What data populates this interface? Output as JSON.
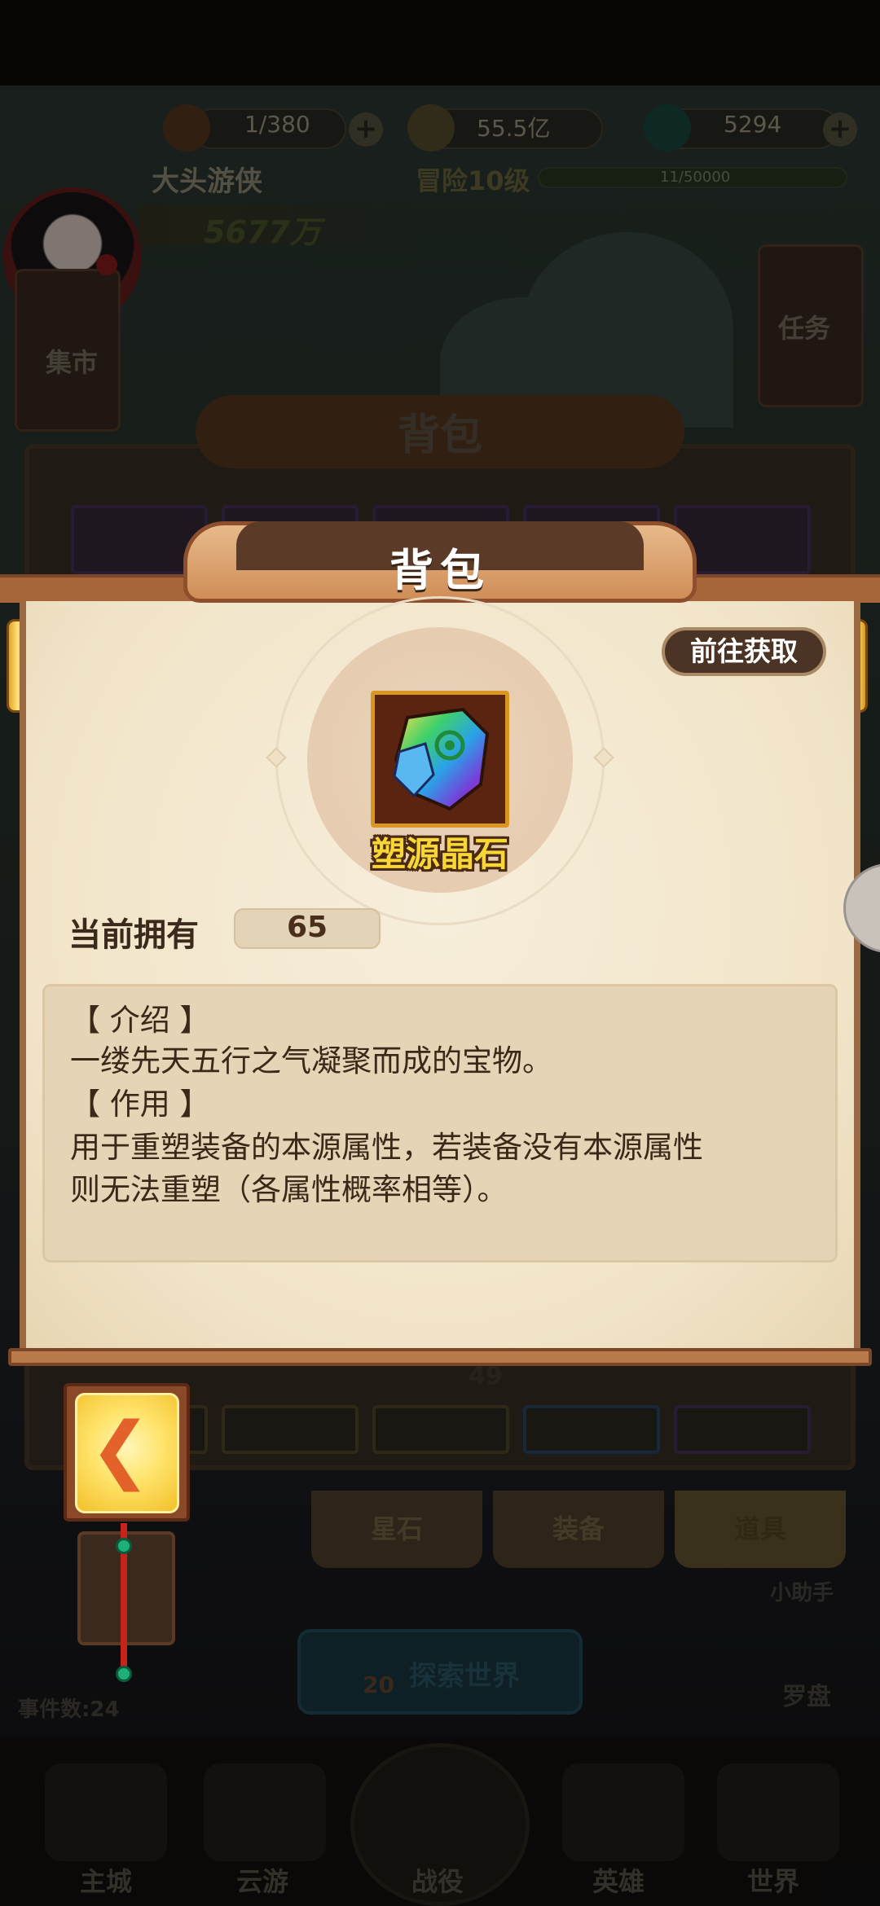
{
  "hud": {
    "stamina": "1/380",
    "gold": "55.5亿",
    "gems": "5294",
    "player_name": "大头游侠",
    "adventure_level": "冒险10级",
    "xp": "11/50000",
    "power": "5677万"
  },
  "background": {
    "market_label": "集市",
    "task_label": "任务",
    "panel_title": "背包",
    "thumb_badge": "49",
    "tabs": [
      "星石",
      "装备",
      "道具"
    ],
    "explore_label": "探索世界",
    "explore_count": "20",
    "events_label": "事件数:24",
    "helper_label": "小助手",
    "compass_label": "罗盘"
  },
  "nav": {
    "items": [
      "主城",
      "云游",
      "战役",
      "英雄",
      "世界"
    ]
  },
  "modal": {
    "title": "背包",
    "goto_button": "前往获取",
    "item_name": "塑源晶石",
    "own_label": "当前拥有",
    "own_value": "65",
    "intro_heading": "【 介绍 】",
    "intro_text": "一缕先天五行之气凝聚而成的宝物。",
    "use_heading": "【 作用 】",
    "use_text_line1": "用于重塑装备的本源属性，若装备没有本源属性",
    "use_text_line2": "则无法重塑（各属性概率相等）。"
  },
  "colors": {
    "paper": "#f1e4c8",
    "accent_gold": "#f7d636",
    "button_dark": "#4b3426",
    "back_arrow": "#e3622a"
  }
}
